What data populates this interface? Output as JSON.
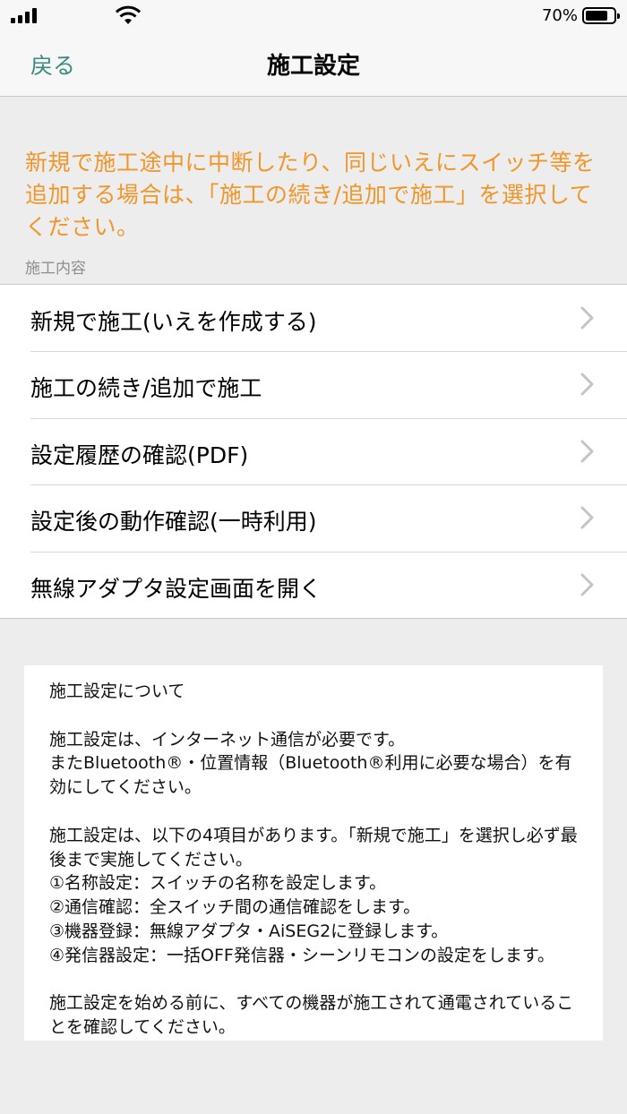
{
  "status_bar": {
    "battery_percent": "70%",
    "battery_level": 0.7
  },
  "nav": {
    "back_label": "戻る",
    "title": "施工設定"
  },
  "notice_text": "新規で施工途中に中断したり、同じいえにスイッチ等を追加する場合は、「施工の続き/追加で施工」を選択してください。",
  "section_header": "施工内容",
  "menu_items": [
    {
      "label": "新規で施工(いえを作成する)"
    },
    {
      "label": "施工の続き/追加で施工"
    },
    {
      "label": "設定履歴の確認(PDF)"
    },
    {
      "label": "設定後の動作確認(一時利用)"
    },
    {
      "label": "無線アダプタ設定画面を開く"
    }
  ],
  "info_box": {
    "text": "施工設定について\n\n施工設定は、インターネット通信が必要です。\nまたBluetooth®・位置情報（Bluetooth®利用に必要な場合）を有効にしてください。\n\n施工設定は、以下の4項目があります。「新規で施工」を選択し必ず最後まで実施してください。\n①名称設定：スイッチの名称を設定します。\n②通信確認：全スイッチ間の通信確認をします。\n③機器登録：無線アダプタ・AiSEG2に登録します。\n④発信器設定：一括OFF発信器・シーンリモコンの設定をします。\n\n施工設定を始める前に、すべての機器が施工されて通電されていることを確認してください。"
  },
  "colors": {
    "accent": "#3b8a80",
    "notice": "#f0962a",
    "background": "#ededed",
    "chevron": "#c4c4c4"
  }
}
